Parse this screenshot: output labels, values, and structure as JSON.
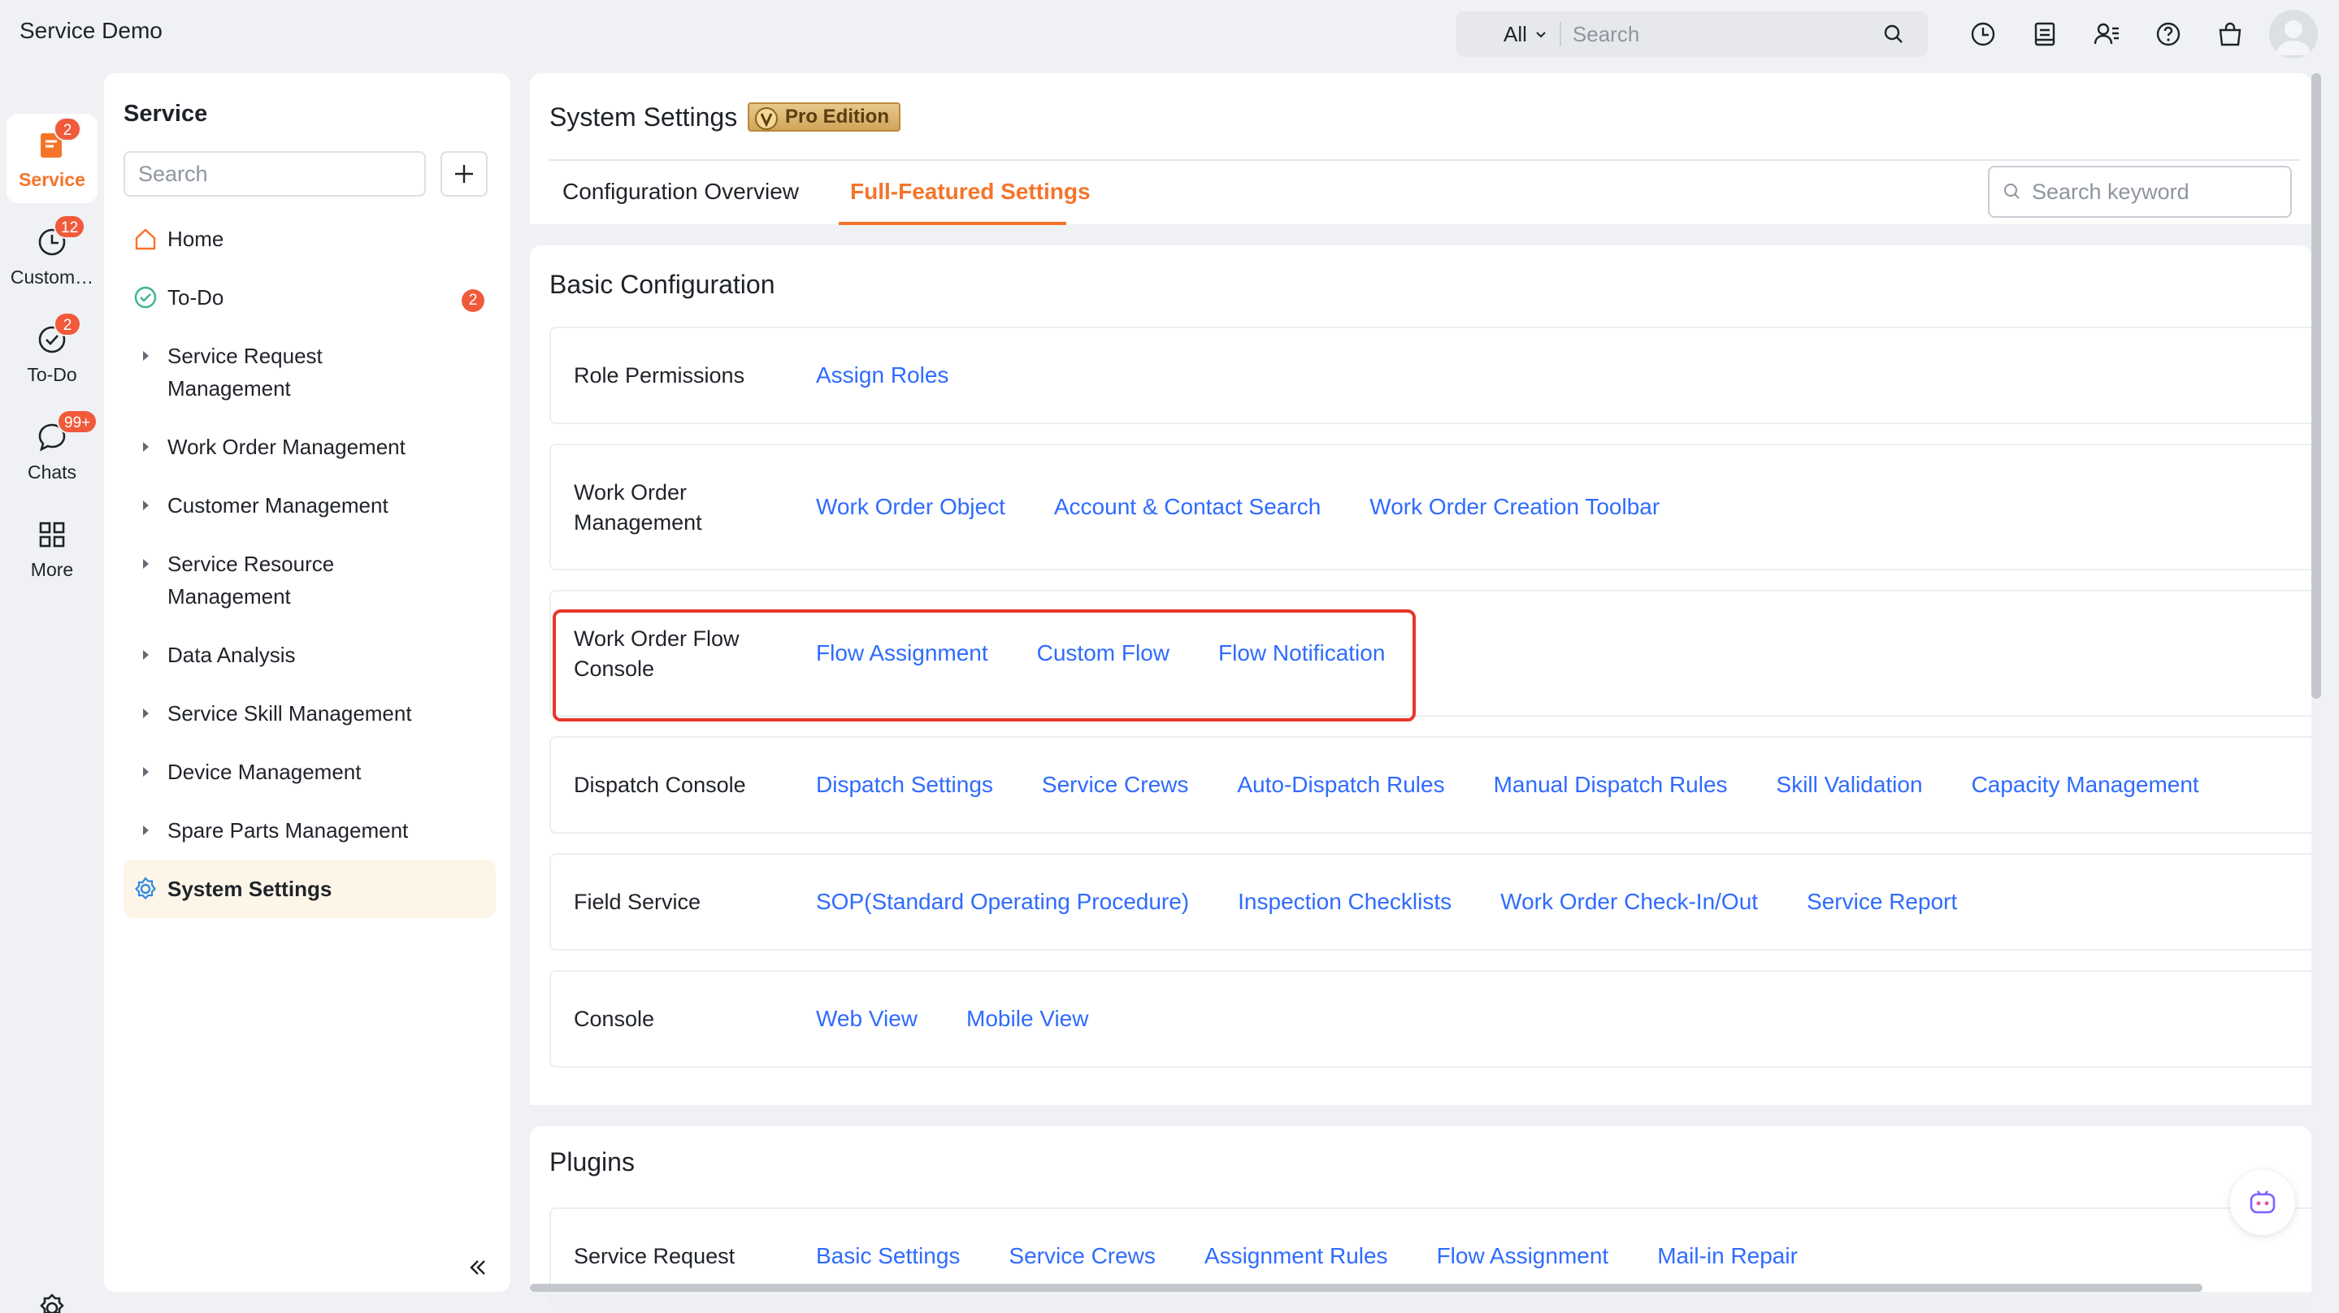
{
  "app": {
    "title": "Service Demo"
  },
  "topbar": {
    "search_scope": "All",
    "search_placeholder": "Search",
    "icons": [
      "search-icon",
      "history-icon",
      "notes-icon",
      "contacts-icon",
      "help-icon",
      "store-icon",
      "user-avatar"
    ]
  },
  "rail": {
    "items": [
      {
        "label": "Service",
        "badge": "2",
        "icon": "service-icon",
        "active": true
      },
      {
        "label": "Custom…",
        "badge": "12",
        "icon": "clock-icon",
        "active": false
      },
      {
        "label": "To-Do",
        "badge": "2",
        "icon": "check-circle-icon",
        "active": false
      },
      {
        "label": "Chats",
        "badge": "99+",
        "icon": "chat-icon",
        "active": false
      },
      {
        "label": "More",
        "badge": "",
        "icon": "grid-icon",
        "active": false
      }
    ]
  },
  "nav": {
    "title": "Service",
    "search_placeholder": "Search",
    "items": [
      {
        "label": "Home",
        "icon": "home-icon"
      },
      {
        "label": "To-Do",
        "icon": "todo-check-icon",
        "badge": "2"
      },
      {
        "label": "Service Request Management",
        "icon": "caret-right-icon"
      },
      {
        "label": "Work Order Management",
        "icon": "caret-right-icon"
      },
      {
        "label": "Customer Management",
        "icon": "caret-right-icon"
      },
      {
        "label": "Service Resource Management",
        "icon": "caret-right-icon"
      },
      {
        "label": "Data Analysis",
        "icon": "caret-right-icon"
      },
      {
        "label": "Service Skill Management",
        "icon": "caret-right-icon"
      },
      {
        "label": "Device Management",
        "icon": "caret-right-icon"
      },
      {
        "label": "Spare Parts Management",
        "icon": "caret-right-icon"
      },
      {
        "label": "System Settings",
        "icon": "gear-icon",
        "active": true
      }
    ]
  },
  "header": {
    "title": "System Settings",
    "edition_badge": "Pro Edition",
    "tabs": [
      "Configuration Overview",
      "Full-Featured Settings"
    ],
    "active_tab": "Full-Featured Settings",
    "keyword_placeholder": "Search keyword"
  },
  "basic": {
    "title": "Basic Configuration",
    "rows": [
      {
        "label": "Role Permissions",
        "links": [
          "Assign Roles"
        ]
      },
      {
        "label": "Work Order Management",
        "links": [
          "Work Order Object",
          "Account & Contact Search",
          "Work Order Creation Toolbar"
        ]
      },
      {
        "label": "Work Order Flow Console",
        "links": [
          "Flow Assignment",
          "Custom Flow",
          "Flow Notification"
        ]
      },
      {
        "label": "Dispatch Console",
        "links": [
          "Dispatch Settings",
          "Service Crews",
          "Auto-Dispatch Rules",
          "Manual Dispatch Rules",
          "Skill Validation",
          "Capacity Management"
        ]
      },
      {
        "label": "Field Service",
        "links": [
          "SOP(Standard Operating Procedure)",
          "Inspection Checklists",
          "Work Order Check-In/Out",
          "Service Report"
        ]
      },
      {
        "label": "Console",
        "links": [
          "Web View",
          "Mobile View"
        ]
      }
    ]
  },
  "plugins": {
    "title": "Plugins",
    "rows": [
      {
        "label": "Service Request",
        "links": [
          "Basic Settings",
          "Service Crews",
          "Assignment Rules",
          "Flow Assignment",
          "Mail-in Repair"
        ]
      }
    ]
  },
  "colors": {
    "accent": "#f5742a",
    "link": "#2f6bff",
    "badge": "#f05a3b",
    "highlight": "#e8372a"
  }
}
